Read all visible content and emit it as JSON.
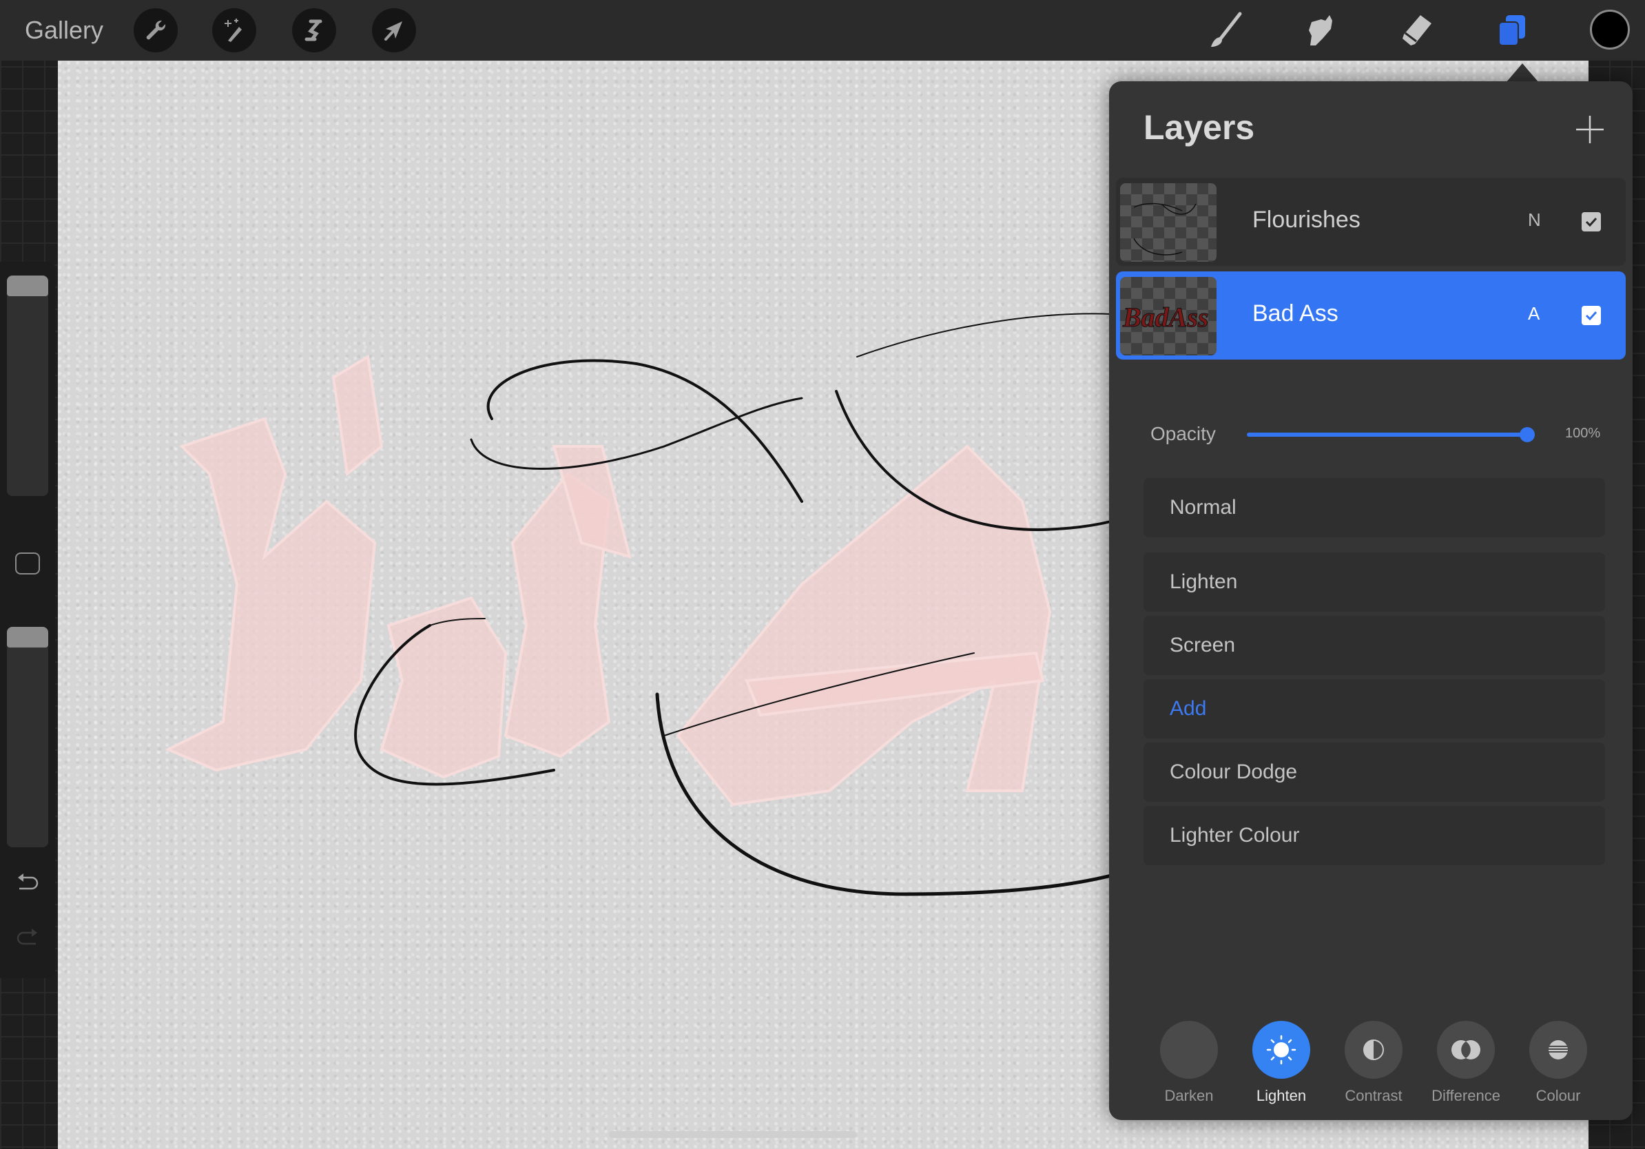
{
  "topbar": {
    "gallery_label": "Gallery",
    "left_tools": [
      {
        "name": "actions",
        "icon": "wrench-icon"
      },
      {
        "name": "adjustments",
        "icon": "magic-wand-icon"
      },
      {
        "name": "selection",
        "icon": "selection-s-icon"
      },
      {
        "name": "transform",
        "icon": "arrow-cursor-icon"
      }
    ],
    "right_tools": [
      {
        "name": "brush",
        "icon": "brush-icon"
      },
      {
        "name": "smudge",
        "icon": "smudge-finger-icon"
      },
      {
        "name": "eraser",
        "icon": "eraser-icon"
      },
      {
        "name": "layers",
        "icon": "layers-icon",
        "active": true
      }
    ],
    "current_color": "#000000",
    "accent_color": "#3375f2"
  },
  "sidebar": {
    "brush_size_level": 1.0,
    "brush_opacity_level": 1.0,
    "modify_button": "square-icon",
    "undo_icon": "undo-icon",
    "redo_icon": "redo-icon"
  },
  "canvas": {
    "artwork_text": "Bad Ass",
    "artwork_description": "Pale pink blackletter 'Bad Ass' with black calligraphic flourishes on grey paper texture"
  },
  "layers_panel": {
    "title": "Layers",
    "add_icon": "plus-icon",
    "layers": [
      {
        "name": "Flourishes",
        "blend_mode_short": "N",
        "visible": true,
        "selected": false
      },
      {
        "name": "Bad Ass",
        "blend_mode_short": "A",
        "visible": true,
        "selected": true,
        "thumbnail_text": "BadAss"
      }
    ],
    "opacity": {
      "label": "Opacity",
      "value_text": "100%",
      "value": 1.0
    },
    "blend_modes": [
      {
        "label": "Normal",
        "selected": false
      },
      {
        "label": "Lighten",
        "selected": false
      },
      {
        "label": "Screen",
        "selected": false
      },
      {
        "label": "Add",
        "selected": true
      },
      {
        "label": "Colour Dodge",
        "selected": false
      },
      {
        "label": "Lighter Colour",
        "selected": false
      }
    ],
    "categories": [
      {
        "label": "Darken",
        "icon": "moon-icon",
        "active": false
      },
      {
        "label": "Lighten",
        "icon": "sun-icon",
        "active": true
      },
      {
        "label": "Contrast",
        "icon": "half-circle-icon",
        "active": false
      },
      {
        "label": "Difference",
        "icon": "overlap-circles-icon",
        "active": false
      },
      {
        "label": "Colour",
        "icon": "striped-circle-icon",
        "active": false
      }
    ]
  }
}
